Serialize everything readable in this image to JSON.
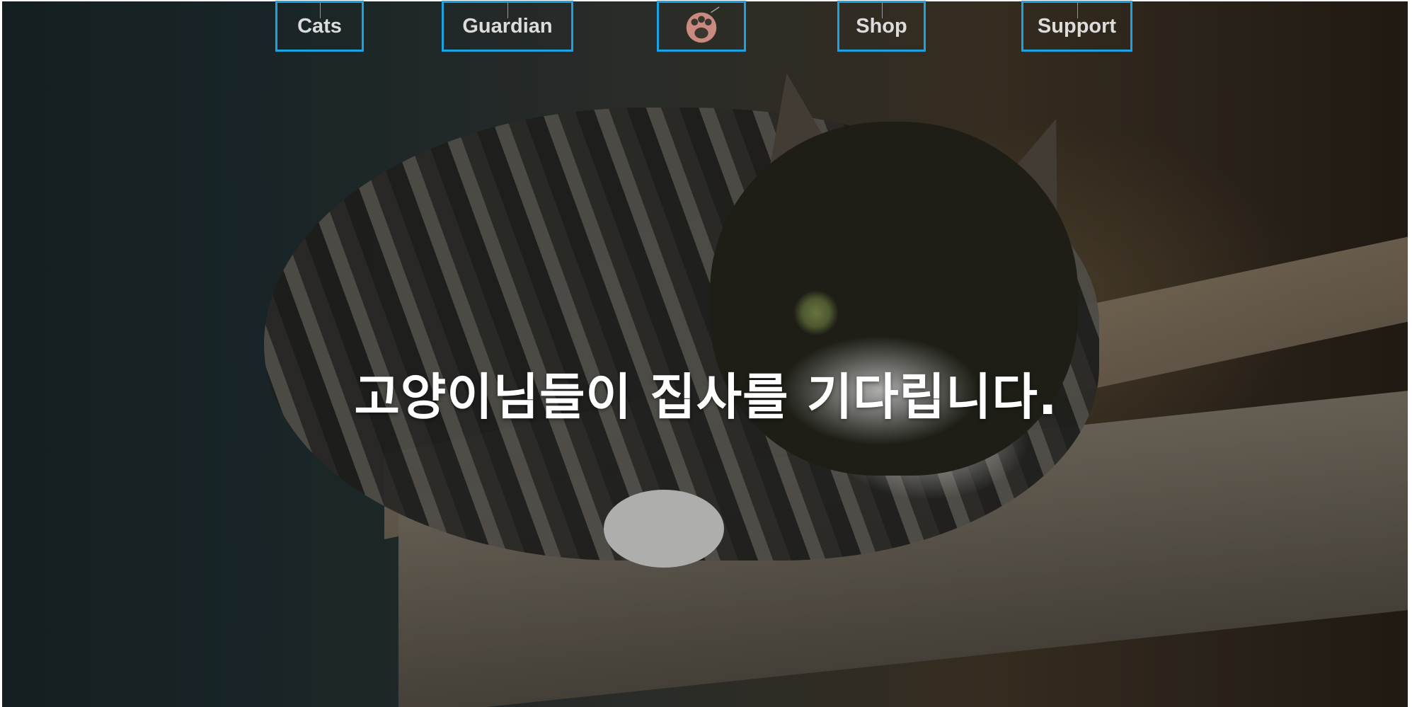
{
  "nav": {
    "items": [
      {
        "label": "Cats"
      },
      {
        "label": "Guardian"
      },
      {
        "label": "",
        "icon": "paw-logo-icon"
      },
      {
        "label": "Shop"
      },
      {
        "label": "Support"
      }
    ],
    "accent_color": "#1aa3e0",
    "logo_color": "#c98a80"
  },
  "hero": {
    "headline": "고양이님들이 집사를 기다립니다.",
    "image": "tabby-cat-lying-on-concrete-ledge"
  }
}
